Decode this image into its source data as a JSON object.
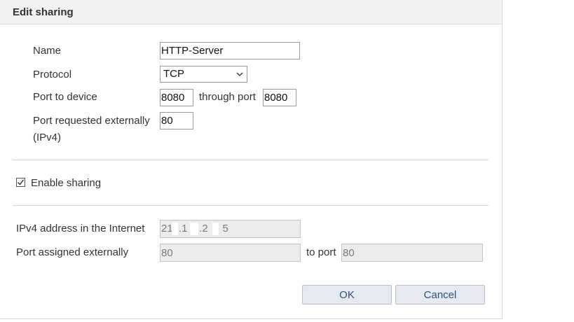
{
  "dialog": {
    "title": "Edit sharing"
  },
  "form": {
    "name_label": "Name",
    "name_value": "HTTP-Server",
    "protocol_label": "Protocol",
    "protocol_value": "TCP",
    "port_device_label": "Port to device",
    "port_device_from": "8080",
    "through_port_label": "through port",
    "port_device_to": "8080",
    "port_external_label_line1": "Port requested externally",
    "port_external_label_line2": "(IPv4)",
    "port_external_value": "80"
  },
  "sharing": {
    "enable_label": "Enable sharing",
    "enabled": true
  },
  "info": {
    "ipv4_label": "IPv4 address in the Internet",
    "ipv4_value": "21  .1    .2  .  5",
    "port_assigned_label": "Port assigned externally",
    "port_assigned_from": "80",
    "to_port_label": "to port",
    "port_assigned_to": "80"
  },
  "buttons": {
    "ok": "OK",
    "cancel": "Cancel"
  },
  "colors": {
    "titlebar_bg": "#f2f2f2",
    "button_bg": "#e6eaf0",
    "button_text": "#2f4f7a",
    "disabled_bg": "#ececec"
  }
}
